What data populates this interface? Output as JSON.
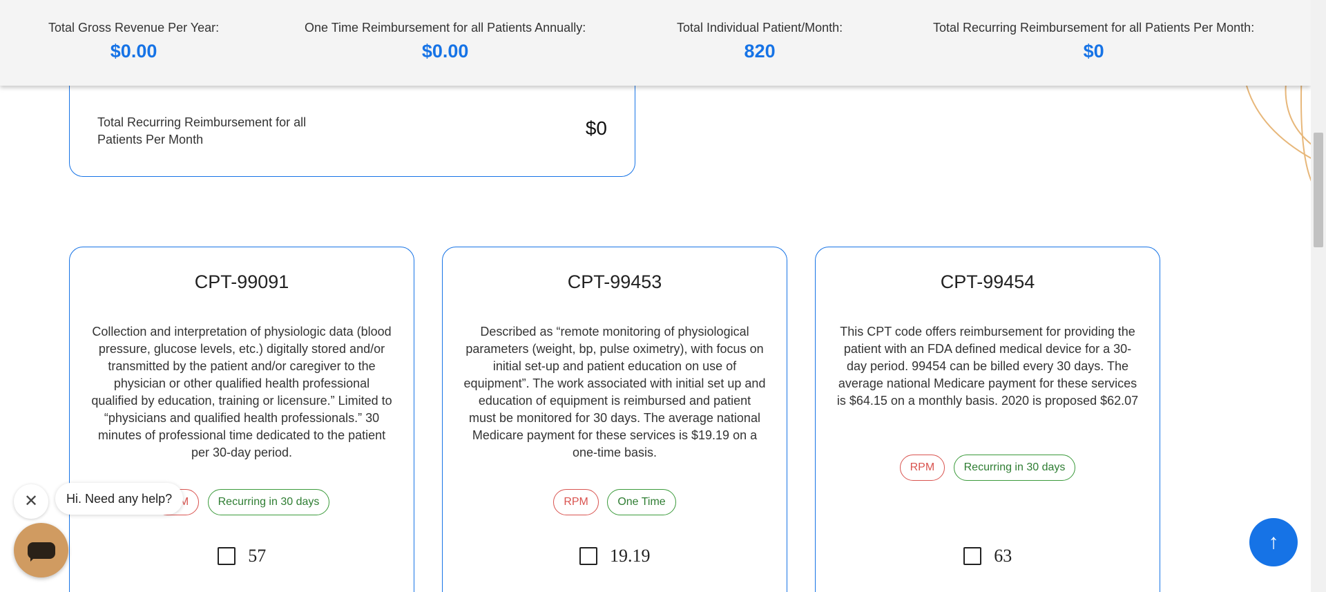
{
  "summary": {
    "gross_revenue_label": "Total Gross Revenue Per Year:",
    "gross_revenue_value": "$0.00",
    "one_time_label": "One Time Reimbursement for all Patients Annually:",
    "one_time_value": "$0.00",
    "individual_patient_label": "Total Individual Patient/Month:",
    "individual_patient_value": "820",
    "recurring_label": "Total Recurring Reimbursement for all Patients Per Month:",
    "recurring_value": "$0"
  },
  "recurring_box": {
    "label": "Total Recurring Reimbursement for all Patients Per Month",
    "value": "$0"
  },
  "cards": [
    {
      "title": "CPT-99091",
      "description": "Collection and interpretation of physiologic data (blood pressure, glucose levels, etc.) digitally stored and/or transmitted by the patient and/or caregiver to the physician or other qualified health professional qualified by education, training or licensure.” Limited to “physicians and qualified health professionals.” 30 minutes of professional time dedicated to the patient per 30-day period.",
      "tag_rpm": "RPM",
      "tag_type": "Recurring in 30 days",
      "price": "57",
      "checked": false
    },
    {
      "title": "CPT-99453",
      "description": "Described as “remote monitoring of physiological parameters (weight, bp, pulse oximetry), with focus on initial set-up and patient education on use of equipment”. The work associated with initial set up and education of equipment is reimbursed and patient must be monitored for 30 days. The average national Medicare payment for these services is $19.19 on a one-time basis.",
      "tag_rpm": "RPM",
      "tag_type": "One Time",
      "price": "19.19",
      "checked": false
    },
    {
      "title": "CPT-99454",
      "description": "This CPT code offers reimbursement for providing the patient with an FDA defined medical device for a 30-day period. 99454 can be billed every 30 days. The average national Medicare payment for these services is $64.15 on a monthly basis. 2020 is proposed $62.07",
      "tag_rpm": "RPM",
      "tag_type": "Recurring in 30 days",
      "price": "63",
      "checked": false
    }
  ],
  "chat": {
    "greeting": "Hi. Need any help?",
    "close_icon": "close-icon",
    "launcher_icon": "chat-bubble-icon"
  },
  "scroll_top_icon": "arrow-up-icon",
  "colors": {
    "accent": "#1673e6",
    "rpm_tag": "#d9534f",
    "type_tag": "#2e7d32",
    "chat_launcher": "#d09b61",
    "decor_arc": "#e7b77a"
  }
}
